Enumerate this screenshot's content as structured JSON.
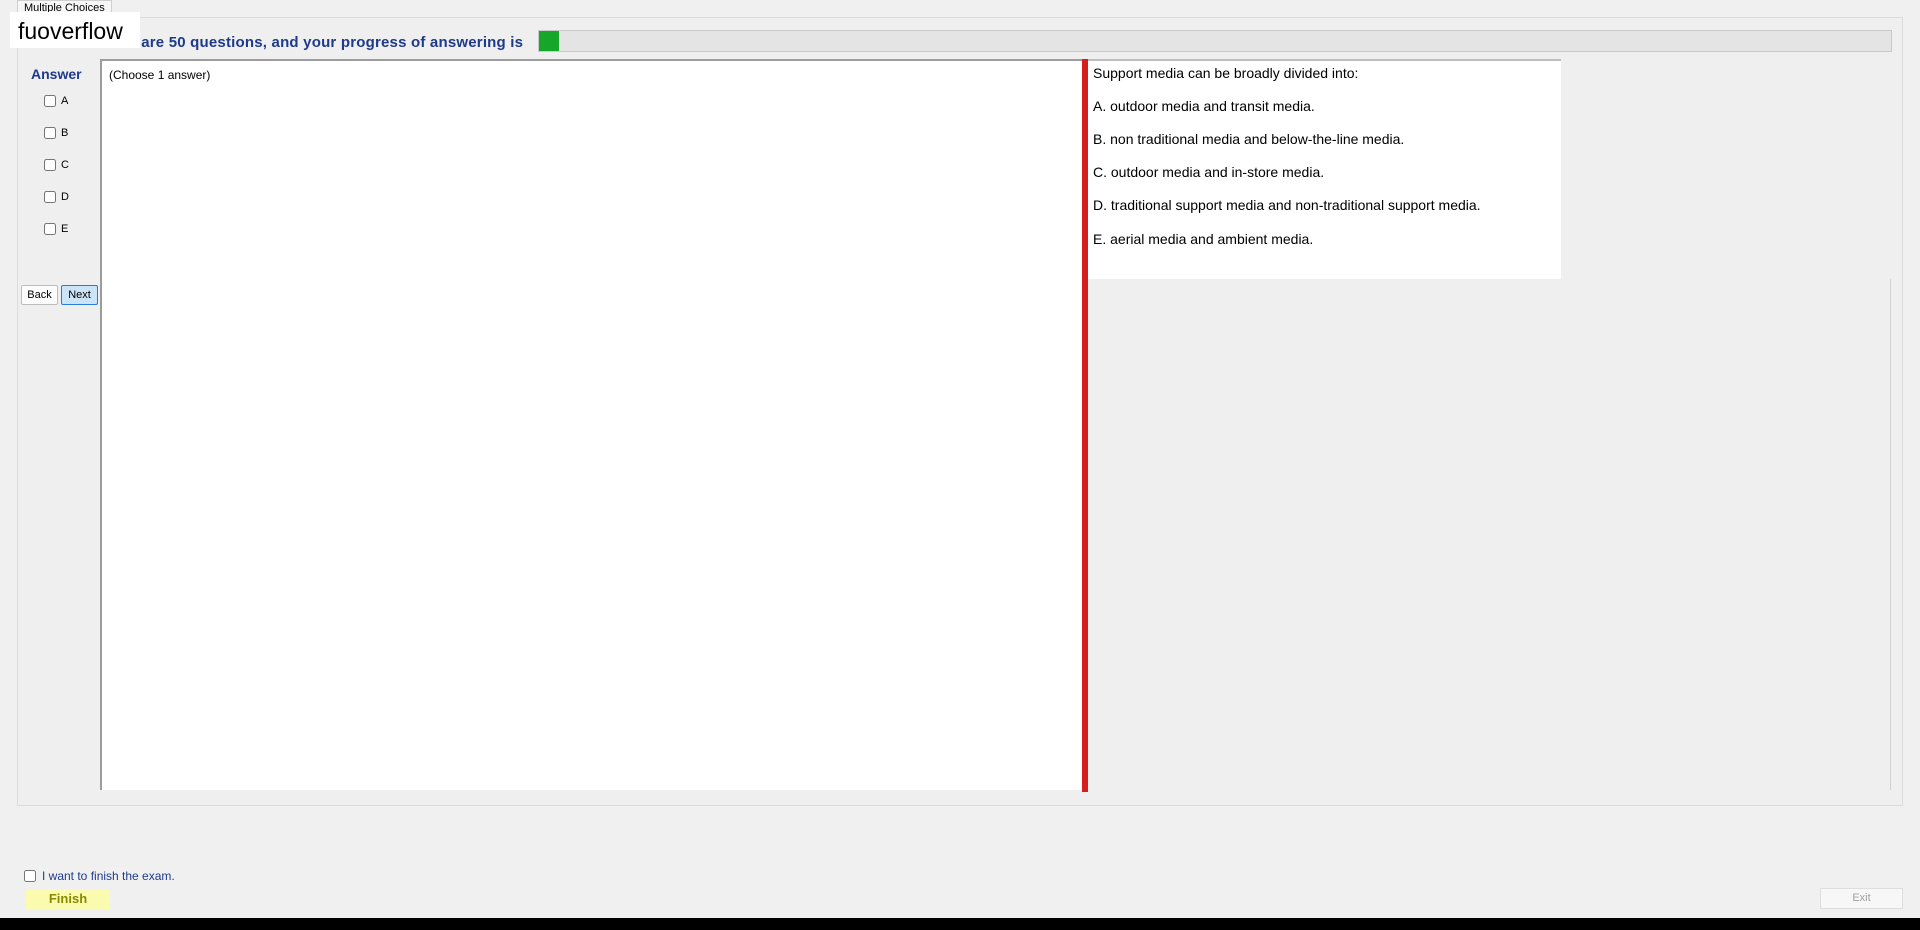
{
  "tab": {
    "label": "Multiple Choices"
  },
  "watermark": {
    "text": "fuoverflow"
  },
  "progress": {
    "text": "There are 50 questions, and your progress of answering is",
    "value": 0.015,
    "fill_color": "#16a62a"
  },
  "answer": {
    "title": "Answer",
    "options": [
      "A",
      "B",
      "C",
      "D",
      "E"
    ]
  },
  "nav": {
    "back_label": "Back",
    "next_label": "Next"
  },
  "question": {
    "hint": "(Choose 1 answer)"
  },
  "choices": {
    "stem": "Support media can be broadly divided into:",
    "items": [
      "A.  outdoor media and transit media.",
      "B.  non traditional media and below-the-line media.",
      "C.  outdoor media and in-store media.",
      "D.  traditional support media and non-traditional support media.",
      "E.  aerial media and ambient media."
    ]
  },
  "footer": {
    "finish_check_label": "I want to finish the exam.",
    "finish_label": "Finish",
    "exit_label": "Exit"
  },
  "colors": {
    "accent_text": "#1e3a8a",
    "divider": "#d51f1f",
    "finish_bg": "#fbfbb0"
  }
}
